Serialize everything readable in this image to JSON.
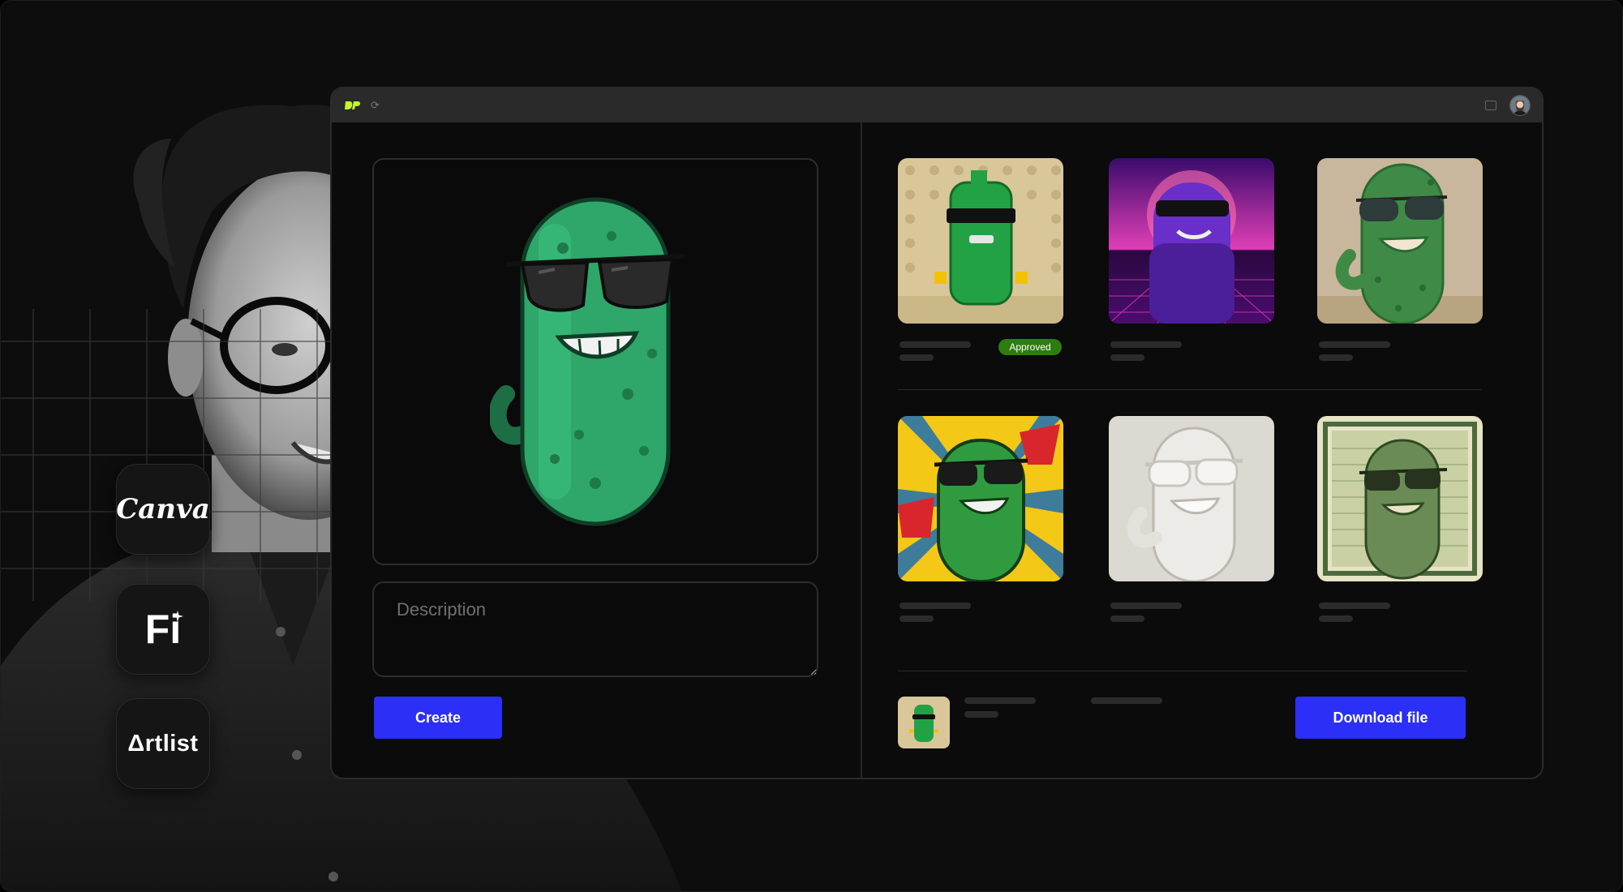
{
  "partners": [
    {
      "name": "Canva",
      "icon": "canva-logo"
    },
    {
      "name": "Fi",
      "icon": "fi-logo"
    },
    {
      "name": "Δrtlist",
      "icon": "artlist-logo"
    }
  ],
  "titlebar": {
    "logo_icon": "dp-logo-icon",
    "reload_icon": "reload-icon",
    "layout_icon": "layout-icon",
    "avatar_icon": "user-avatar"
  },
  "editor": {
    "description_placeholder": "Description",
    "create_label": "Create"
  },
  "gallery": {
    "items": [
      {
        "style": "lego",
        "badge": "Approved"
      },
      {
        "style": "synthwave"
      },
      {
        "style": "clay"
      },
      {
        "style": "comic"
      },
      {
        "style": "marble"
      },
      {
        "style": "engraving"
      }
    ]
  },
  "footer": {
    "download_label": "Download file"
  },
  "colors": {
    "accent": "#2b2ff7",
    "approved": "#2e7d10",
    "pickle": "#2fa66a",
    "logo": "#c6f42e"
  }
}
